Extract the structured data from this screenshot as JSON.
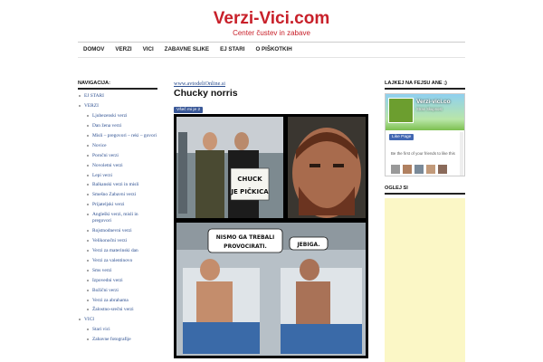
{
  "site": {
    "title": "Verzi-Vici.com",
    "tagline": "Center čustev in zabave"
  },
  "nav": [
    "DOMOV",
    "VERZI",
    "VICI",
    "ZABAVNE SLIKE",
    "EJ STARI",
    "O PIŠKOTKIH"
  ],
  "sidebar_left": {
    "title": "NAVIGACIJA:",
    "items": [
      {
        "label": "EJ STARI",
        "level": 0
      },
      {
        "label": "VERZI",
        "level": 0
      },
      {
        "label": "Ljubezenski verzi",
        "level": 1
      },
      {
        "label": "Dan žena verzi",
        "level": 1
      },
      {
        "label": "Misli – pregovori – reki – govori",
        "level": 1
      },
      {
        "label": "Novice",
        "level": 1
      },
      {
        "label": "Poročni verzi",
        "level": 1
      },
      {
        "label": "Novoletni verzi",
        "level": 1
      },
      {
        "label": "Lepi verzi",
        "level": 1
      },
      {
        "label": "Balkanski verzi in misli",
        "level": 1
      },
      {
        "label": "Smešno Zabavni verzi",
        "level": 1
      },
      {
        "label": "Prijateljski verzi",
        "level": 1
      },
      {
        "label": "Angleški verzi, misli in pregovori",
        "level": 1
      },
      {
        "label": "Rojstnodnevni verzi",
        "level": 1
      },
      {
        "label": "Velikonočni verzi",
        "level": 1
      },
      {
        "label": "Verzi za materinski dan",
        "level": 1
      },
      {
        "label": "Verzi za valentinovo",
        "level": 1
      },
      {
        "label": "Sms verzi",
        "level": 1
      },
      {
        "label": "Izpovedni verzi",
        "level": 1
      },
      {
        "label": "Božični verzi",
        "level": 1
      },
      {
        "label": "Verzi za abrahama",
        "level": 1
      },
      {
        "label": "Žalostno-srečni verzi",
        "level": 1
      },
      {
        "label": "VICI",
        "level": 0
      },
      {
        "label": "Stari vici",
        "level": 1
      },
      {
        "label": "Zabavne fotografije",
        "level": 1
      }
    ]
  },
  "main": {
    "source_link": "www.avtodeliOnline.si",
    "post_title": "Chucky norris",
    "share_label": "Všeč mi je 2",
    "meme": {
      "sign_text": "CHUCK JE PIČKICA",
      "bubble_left": "NISMO GA TREBALI PROVOCIRATI.",
      "bubble_right": "JEBIGA."
    }
  },
  "sidebar_right": {
    "fb_title": "LAJKEJ NA FEJSU ANE ;)",
    "fb_page_name": "Verzi-vici.co",
    "fb_page_sub": "Stran Skupnost",
    "fb_like_label": "Like Page",
    "fb_friends_text": "Be the first of your friends to like this",
    "ad_title": "OGLEJ SI"
  }
}
